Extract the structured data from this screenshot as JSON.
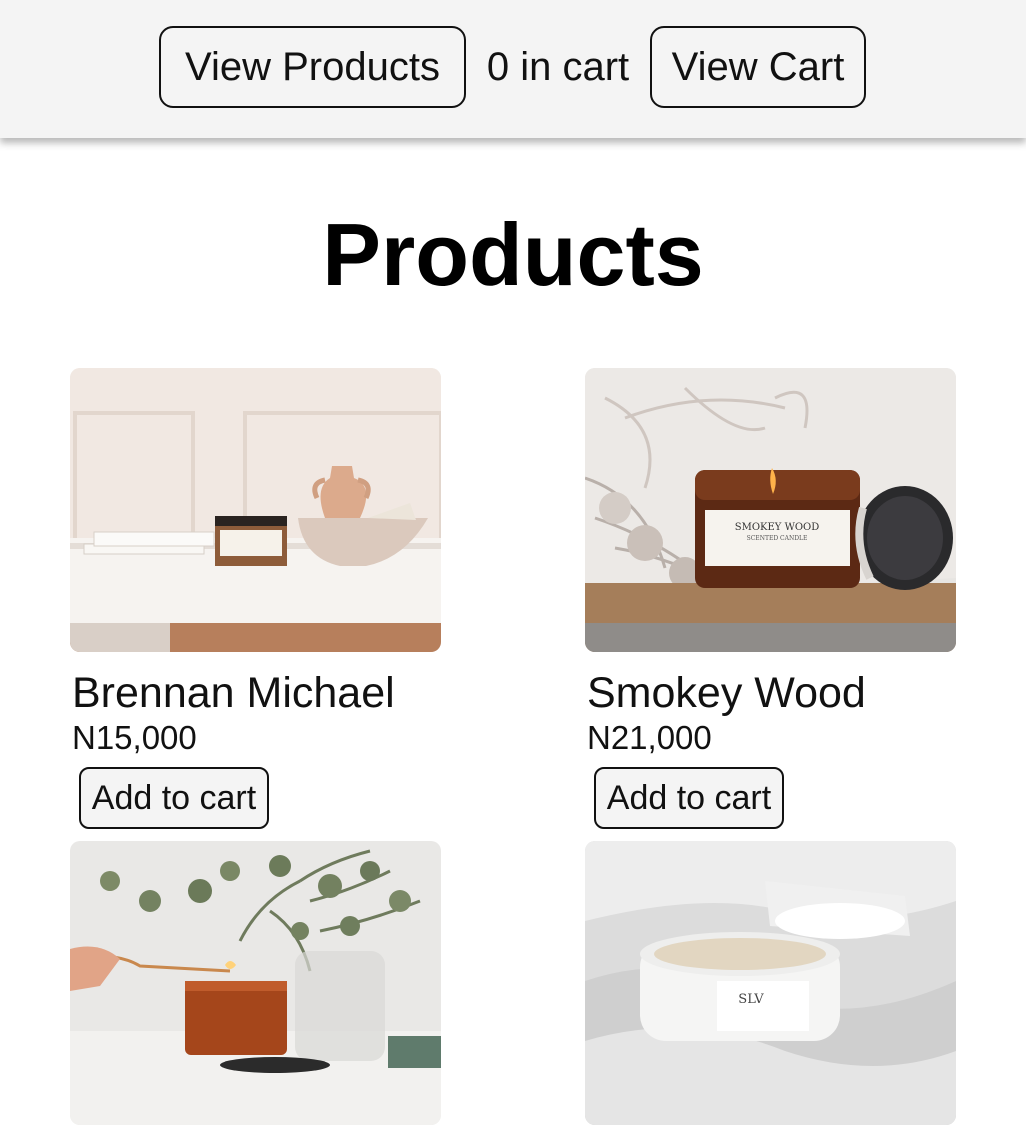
{
  "nav": {
    "view_products_label": "View Products",
    "cart_count_text": "0 in cart",
    "view_cart_label": "View Cart"
  },
  "page_title": "Products",
  "products": [
    {
      "name": "Brennan Michael",
      "price": "N15,000",
      "button_label": "Add to cart"
    },
    {
      "name": "Smokey Wood",
      "price": "N21,000",
      "button_label": "Add to cart"
    },
    {
      "name": "",
      "price": "",
      "button_label": ""
    },
    {
      "name": "",
      "price": "",
      "button_label": ""
    }
  ],
  "product_image_labels": {
    "smokey_wood_jar_label": "SMOKEY WOOD",
    "smokey_wood_jar_sublabel": "SCENTED CANDLE",
    "white_candle_label": "SLV"
  },
  "colors": {
    "topbar_bg": "#f4f4f4",
    "button_bg": "#f4f4f4",
    "button_border": "#111111",
    "text": "#111111"
  },
  "icons": {
    "candle_images": [
      "candle-photo-beige-room",
      "candle-photo-smokey-wood",
      "candle-photo-amber-lit",
      "candle-photo-white-sheets"
    ]
  }
}
